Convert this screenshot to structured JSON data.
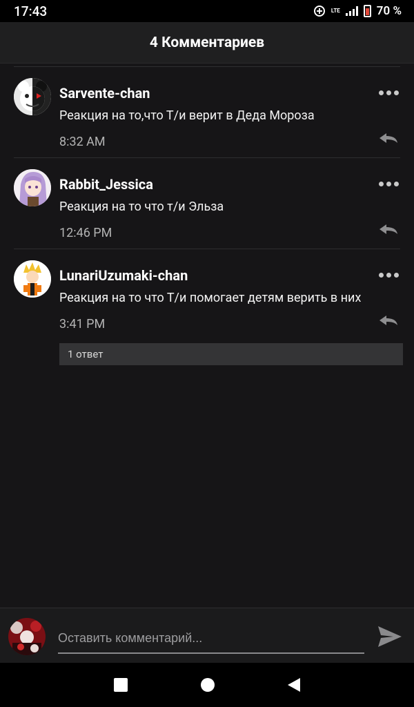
{
  "status_bar": {
    "time": "17:43",
    "battery": "70 %",
    "network": "LTE"
  },
  "header": {
    "title": "4 Комментариев"
  },
  "comments": [
    {
      "author": "Sarvente-chan",
      "text": "Реакция на то,что Т/и верит в Деда Мороза",
      "time": "8:32 AM",
      "avatar_icon": "monokuma-avatar"
    },
    {
      "author": "Rabbit_Jessica",
      "text": "Реакция на то что т/и Эльза",
      "time": "12:46 PM",
      "avatar_icon": "anime-girl-avatar"
    },
    {
      "author": "LunariUzumaki-chan",
      "text": "Реакция на то что Т/и помогает детям верить в них",
      "time": "3:41 PM",
      "avatar_icon": "naruto-avatar",
      "replies_label": "1 ответ"
    }
  ],
  "input": {
    "placeholder": "Оставить комментарий..."
  },
  "colors": {
    "background": "#161517",
    "header": "#1f1f20",
    "replies_bar": "#343436",
    "text_secondary": "#b3b3b3"
  }
}
